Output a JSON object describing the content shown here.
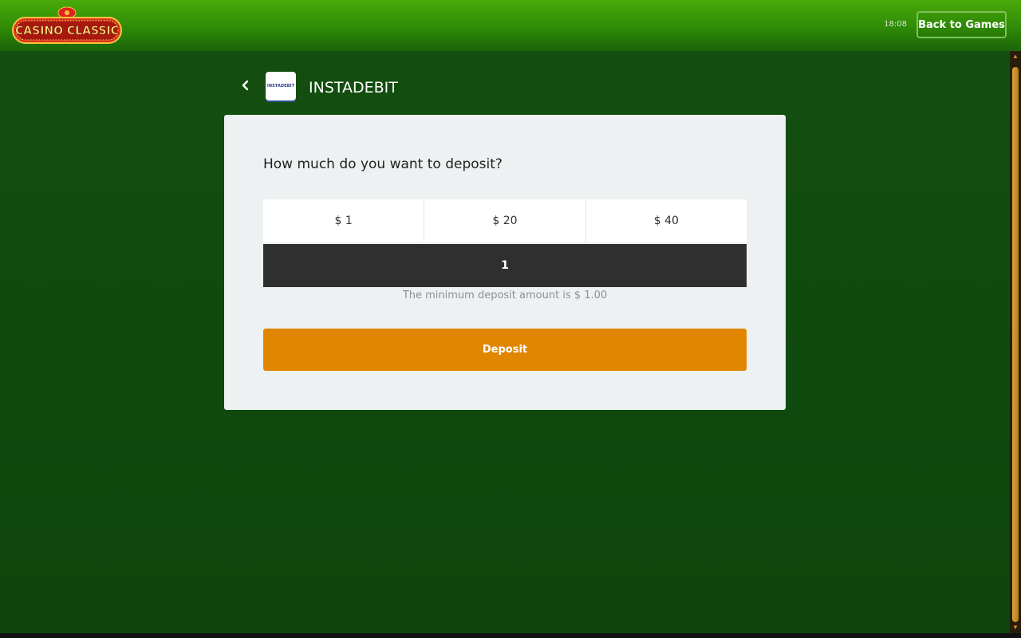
{
  "header": {
    "logo_text": "CASINO CLASSIC",
    "clock": "18:08",
    "back_button_label": "Back to Games"
  },
  "method": {
    "logo_text": "INSTADEBIT",
    "title": "INSTADEBIT"
  },
  "deposit_form": {
    "question": "How much do you want to deposit?",
    "amount_options": [
      "$ 1",
      "$ 20",
      "$ 40"
    ],
    "amount_value": "1",
    "min_note": "The minimum deposit amount is $ 1.00",
    "deposit_label": "Deposit"
  },
  "colors": {
    "header_green": "#3a9a08",
    "background_green": "#0f4a0e",
    "card_bg": "#eef1f2",
    "input_bg": "#2f2f2f",
    "deposit_orange": "#e08600"
  }
}
